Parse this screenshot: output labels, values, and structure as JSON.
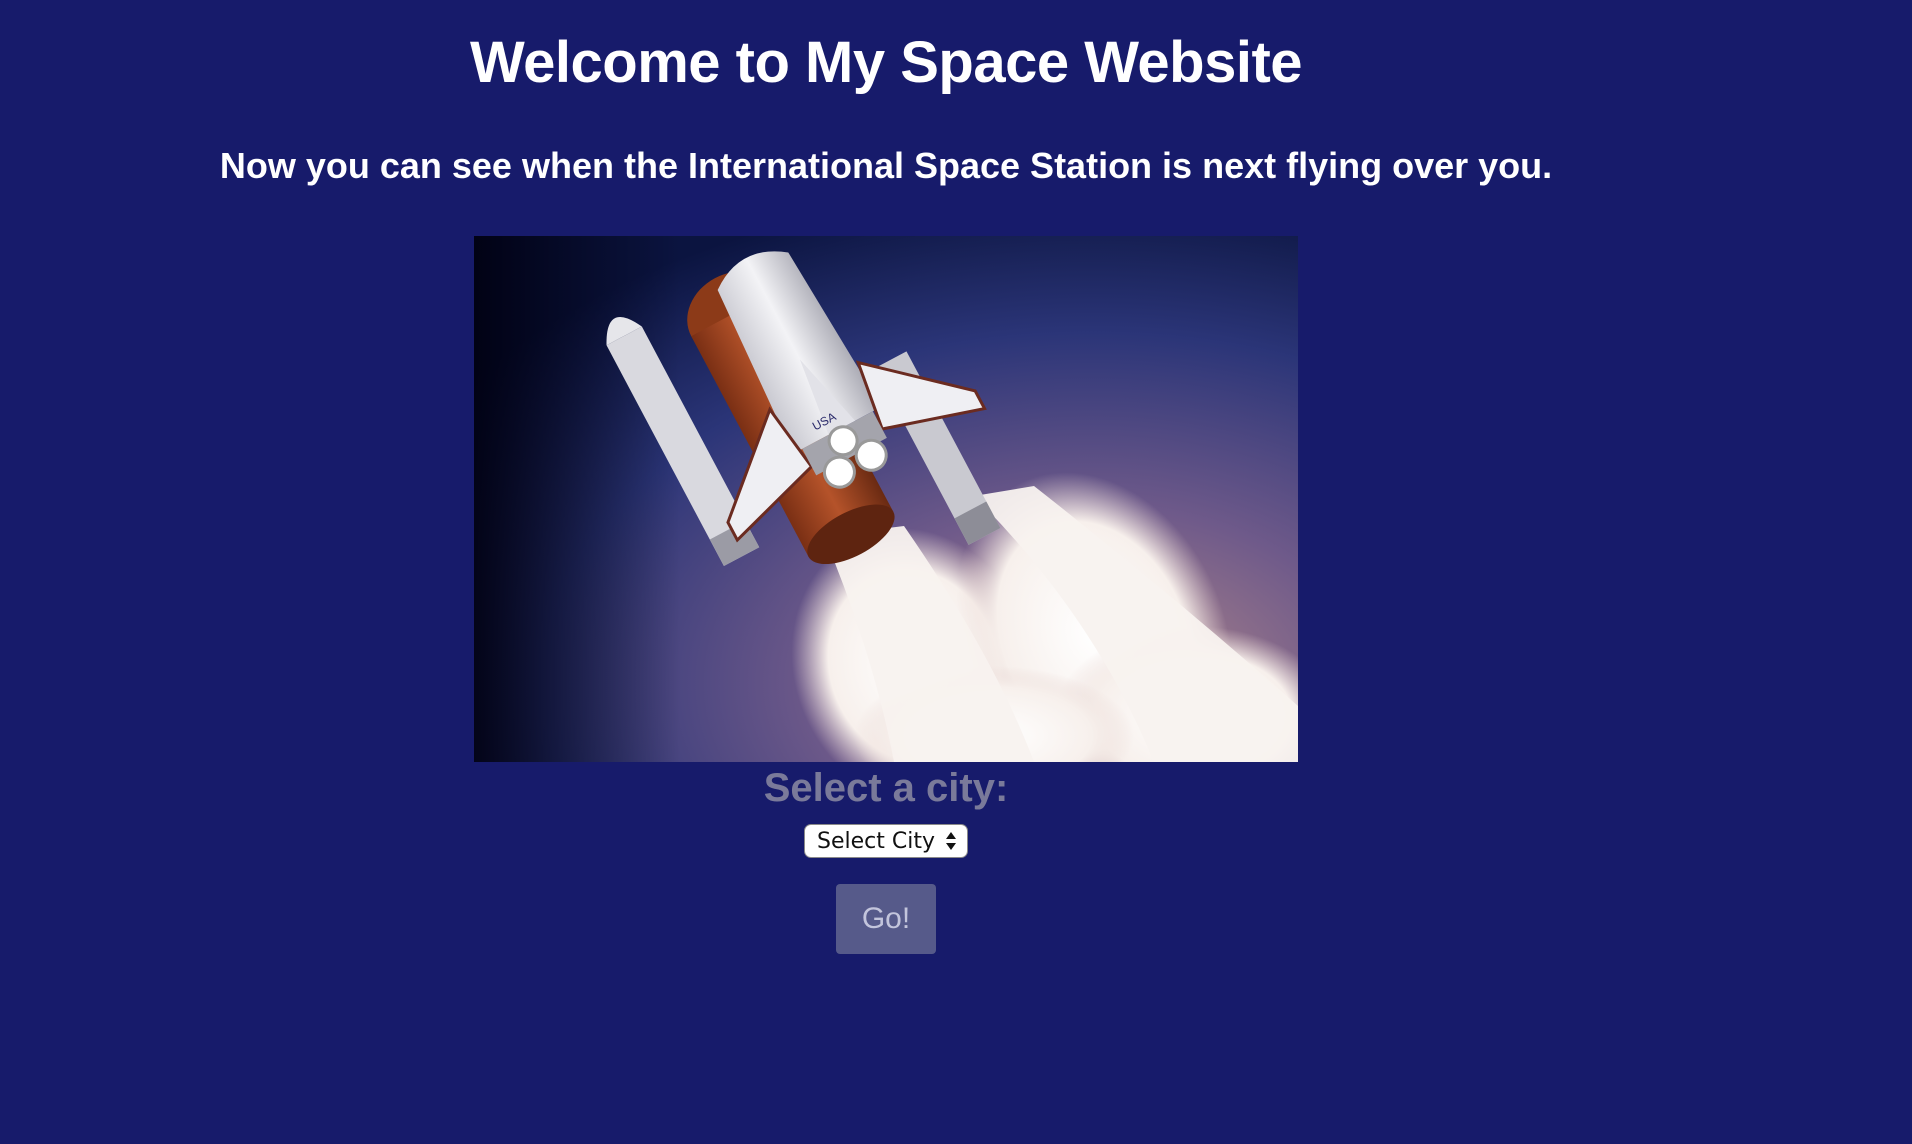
{
  "page": {
    "title": "Welcome to My Space Website",
    "subtitle": "Now you can see when the International Space Station is next flying over you."
  },
  "hero_image": {
    "icon": "space-shuttle-launch-image",
    "badge_text": "USA"
  },
  "city_form": {
    "label": "Select a city:",
    "select_value": "Select City",
    "go_label": "Go!"
  },
  "colors": {
    "background": "#171b6b",
    "text": "#ffffff",
    "label": "#7a7a9a",
    "button_bg": "#565a8a",
    "button_text": "#c3c5dc"
  }
}
